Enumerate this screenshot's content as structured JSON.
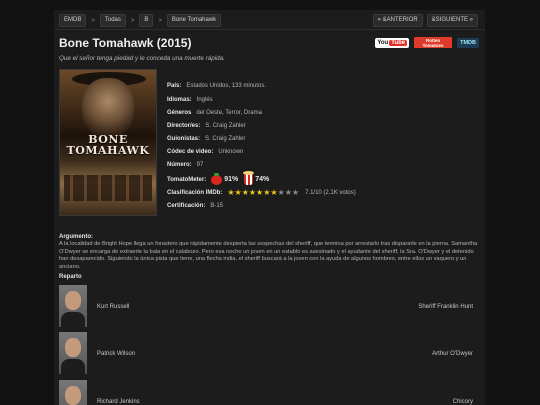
{
  "breadcrumb": [
    "EMDB",
    "Todas",
    "B",
    "Bone Tomahawk"
  ],
  "nav": {
    "prev": "« &ANTERIOR",
    "next": "&SIGUIENTE »"
  },
  "movie": {
    "title": "Bone Tomahawk (2015)",
    "tagline": "Que el señor tenga piedad y le conceda una muerte rápida.",
    "poster_text": "BONE TOMAHAWK"
  },
  "external": {
    "youtube_a": "You",
    "youtube_b": "Tube",
    "rt": "Rotten Tomatoes",
    "tmdb": "TMDB"
  },
  "details": [
    {
      "label": "País:",
      "value": "Estados Unidos, 133 minutos."
    },
    {
      "label": "Idiomas:",
      "value": "Inglés"
    },
    {
      "label": "Géneros",
      "value": "del Oeste, Terror, Drama"
    },
    {
      "label": "Director/es:",
      "value": "S. Craig Zahler"
    },
    {
      "label": "Guionistas:",
      "value": "S. Craig Zahler"
    },
    {
      "label": "Códec de video:",
      "value": "Unknown"
    },
    {
      "label": "Número:",
      "value": "97"
    }
  ],
  "tomatometer": {
    "label": "TomatoMeter:",
    "critics": "91%",
    "audience": "74%"
  },
  "imdb": {
    "label": "Clasificación IMDb:",
    "stars_on": 7,
    "stars_total": 10,
    "value": "7.1/10 (2.1K votos)"
  },
  "certification": {
    "label": "Certificación:",
    "value": "B-15"
  },
  "plot": {
    "label": "Argumento:",
    "text": "A la localidad de Bright Hope llega un forastero que rápidamente despierta las sospechas del sheriff, que termina por arrestarlo tras dispararle en la pierna. Samantha O'Dwyer se encarga de extraerle la bala en el calabozo. Pero esa noche un joven en un establo es asesinado y el ayudante del sheriff, la Sra. O'Dwyer y el detenido han desaparecido. Siguiendo la única pista que tiene, una flecha india, el sheriff buscará a la joven con la ayuda de algunos hombres, entre ellos un vaquero y un anciano."
  },
  "cast": {
    "label": "Reparto",
    "members": [
      {
        "name": "Kurt Russell",
        "role": "Sheriff Franklin Hunt"
      },
      {
        "name": "Patrick Wilson",
        "role": "Arthur O'Dwyer"
      },
      {
        "name": "Richard Jenkins",
        "role": "Chicory"
      }
    ]
  }
}
